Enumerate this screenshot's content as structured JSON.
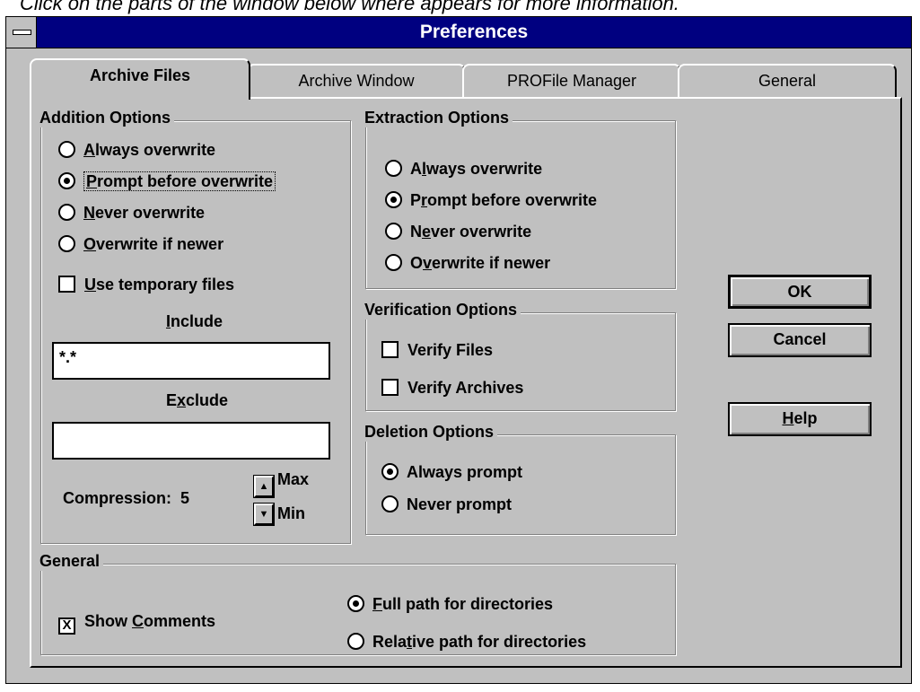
{
  "hint": "Click on the parts of the window below where  appears for more information.",
  "window": {
    "title": "Preferences"
  },
  "tabs": [
    {
      "label": "Archive Files",
      "active": true
    },
    {
      "label": "Archive Window",
      "active": false
    },
    {
      "label": "PROFile Manager",
      "active": false
    },
    {
      "label": "General",
      "active": false
    }
  ],
  "addition_options": {
    "title": "Addition Options",
    "options": [
      {
        "pre": "",
        "key": "A",
        "post": "lways overwrite",
        "selected": false
      },
      {
        "pre": "",
        "key": "P",
        "post": "rompt before overwrite",
        "selected": true
      },
      {
        "pre": "",
        "key": "N",
        "post": "ever overwrite",
        "selected": false
      },
      {
        "pre": "",
        "key": "O",
        "post": "verwrite if newer",
        "selected": false
      }
    ],
    "temp_files": {
      "pre": "",
      "key": "U",
      "post": "se temporary files",
      "checked": false
    },
    "include": {
      "pre": "",
      "key": "I",
      "post": "nclude",
      "value": "*.*"
    },
    "exclude": {
      "pre": "E",
      "key": "x",
      "post": "clude",
      "value": ""
    },
    "compression": {
      "label": "Compression:",
      "value": "5",
      "max_label": "Max",
      "min_label": "Min"
    }
  },
  "extraction_options": {
    "title": "Extraction Options",
    "options": [
      {
        "pre": "A",
        "key": "l",
        "post": "ways overwrite",
        "selected": false
      },
      {
        "pre": "P",
        "key": "r",
        "post": "ompt before overwrite",
        "selected": true
      },
      {
        "pre": "N",
        "key": "e",
        "post": "ver overwrite",
        "selected": false
      },
      {
        "pre": "O",
        "key": "v",
        "post": "erwrite if newer",
        "selected": false
      }
    ]
  },
  "verification_options": {
    "title": "Verification Options",
    "verify_files": {
      "label": "Verify Files",
      "checked": false
    },
    "verify_archives": {
      "label": "Verify Archives",
      "checked": false
    }
  },
  "deletion_options": {
    "title": "Deletion Options",
    "always_prompt": {
      "label": "Always prompt",
      "selected": true
    },
    "never_prompt": {
      "label": "Never prompt",
      "selected": false
    }
  },
  "general": {
    "title": "General",
    "show_comments": {
      "pre": "Show ",
      "key": "C",
      "post": "omments",
      "checked": true,
      "mark": "X"
    },
    "full_path": {
      "pre": "",
      "key": "F",
      "post": "ull path for directories",
      "selected": true
    },
    "relative_path": {
      "pre": "Rela",
      "key": "t",
      "post": "ive path for directories",
      "selected": false
    }
  },
  "buttons": {
    "ok": "OK",
    "cancel": "Cancel",
    "help": {
      "pre": "",
      "key": "H",
      "post": "elp"
    }
  },
  "icons": {
    "spin_up": "▲",
    "spin_down": "▼"
  }
}
